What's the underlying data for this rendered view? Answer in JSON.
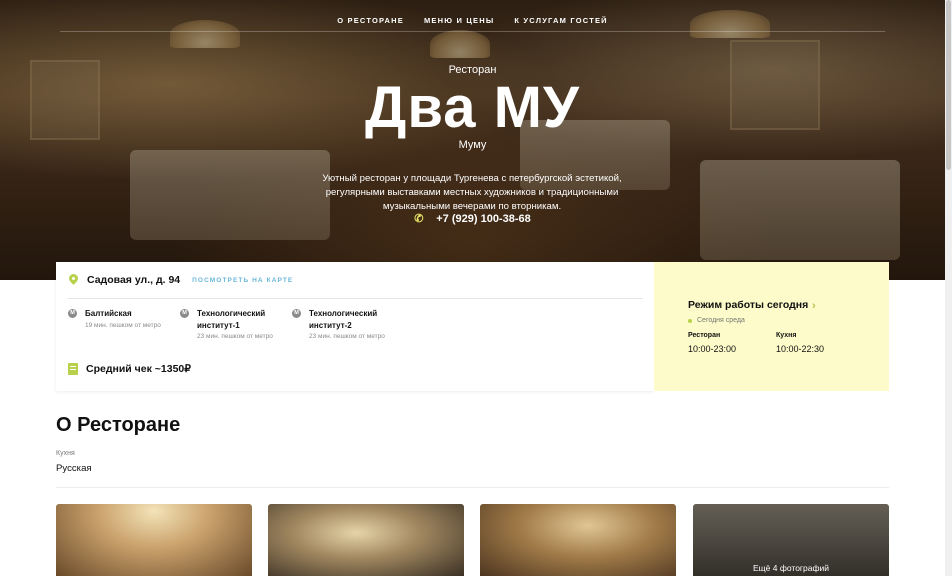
{
  "nav": {
    "items": [
      "О ресторане",
      "Меню и цены",
      "К услугам гостей"
    ]
  },
  "hero": {
    "kind": "Ресторан",
    "title": "Два МУ",
    "subtitle": "Муму",
    "description": "Уютный ресторан у площади Тургенева с петербургской эстетикой, регулярными выставками местных художников и традиционными музыкальными вечерами по вторникам.",
    "phone": "+7 (929) 100-38-68",
    "phone_icon": "phone-icon"
  },
  "info": {
    "address": "Садовая ул., д. 94",
    "map_link": "Посмотреть на карте",
    "metros": [
      {
        "name": "Балтийская",
        "time": "19 мин. пешком от метро"
      },
      {
        "name": "Технологический институт-1",
        "time": "23 мин. пешком от метро"
      },
      {
        "name": "Технологический институт-2",
        "time": "23 мин. пешком от метро"
      }
    ],
    "metro_badge": "М",
    "avg_check": "Средний чек ~1350₽"
  },
  "hours": {
    "title": "Режим работы сегодня",
    "today": "Сегодня среда",
    "restaurant_label": "Ресторан",
    "restaurant_hours": "10:00-23:00",
    "kitchen_label": "Кухня",
    "kitchen_hours": "10:00-22:30",
    "chevron": "›"
  },
  "about": {
    "title": "О Ресторане",
    "cuisine_label": "Кухня",
    "cuisine_value": "Русская"
  },
  "photos": {
    "more_label": "Ещё 4 фотографий"
  },
  "colors": {
    "accent_green": "#b7d24a",
    "link_blue": "#68b7d9",
    "hours_bg": "#fcfbc9"
  }
}
